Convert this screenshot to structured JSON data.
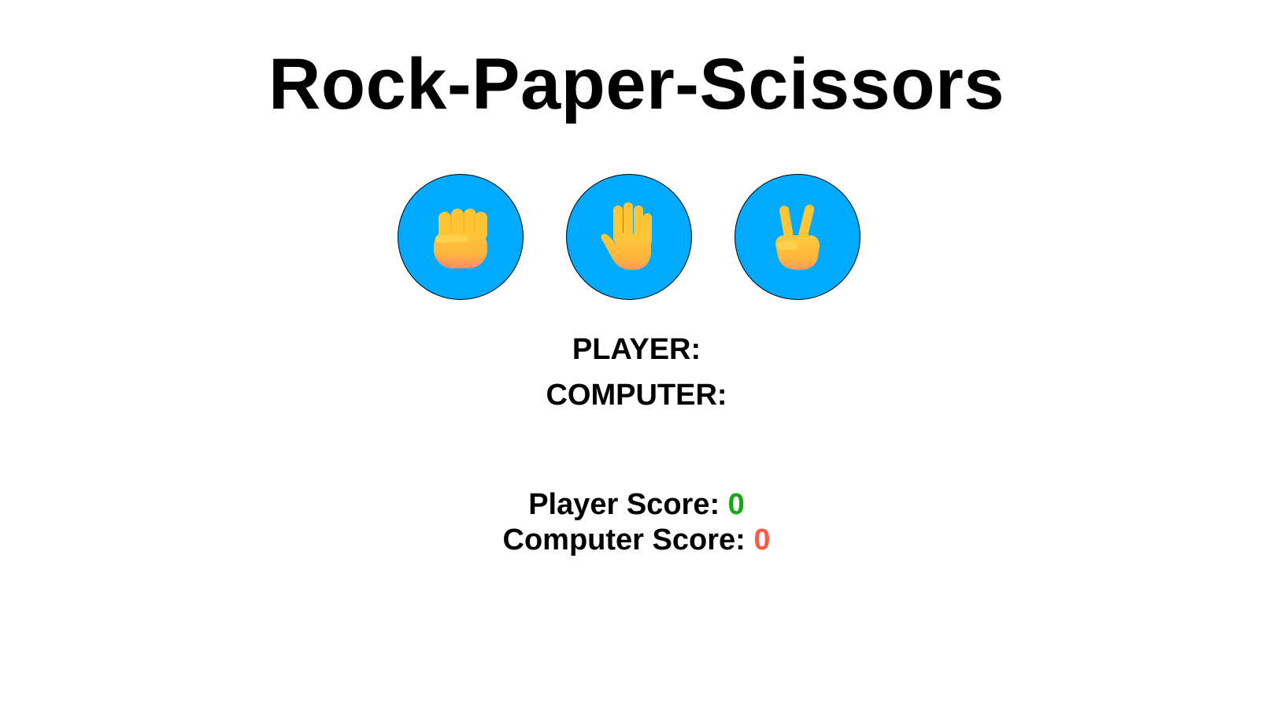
{
  "title": "Rock-Paper-Scissors",
  "choices": [
    {
      "name": "rock",
      "icon": "raised-fist-icon"
    },
    {
      "name": "paper",
      "icon": "raised-hand-icon"
    },
    {
      "name": "scissors",
      "icon": "victory-hand-icon"
    }
  ],
  "colors": {
    "button_background": "#00aaff",
    "player_score": "#11aa11",
    "computer_score": "#ff5a46"
  },
  "labels": {
    "player": "PLAYER:",
    "computer": "COMPUTER:"
  },
  "scores": {
    "player_label": "Player Score: ",
    "player_value": "0",
    "computer_label": "Computer Score: ",
    "computer_value": "0"
  }
}
